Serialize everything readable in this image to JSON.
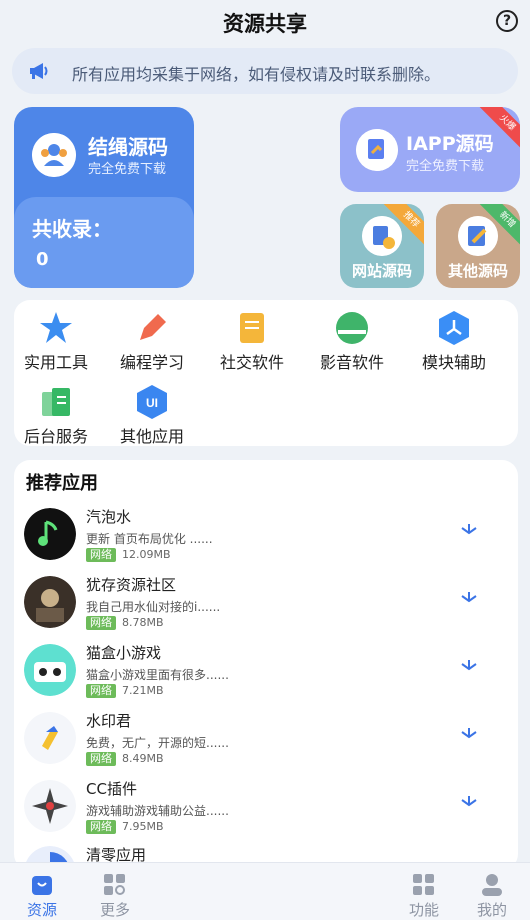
{
  "header": {
    "title": "资源共享",
    "help_icon": "help-icon",
    "help_glyph": "?"
  },
  "notice": {
    "text": "所有应用均采集于网络，如有侵权请及时联系删除。",
    "icon": "megaphone-icon"
  },
  "featured": {
    "main": {
      "name": "结绳源码",
      "subtitle": "完全免费下载",
      "count_label": "共收录：",
      "count": "0"
    },
    "iapp": {
      "name": "IAPP源码",
      "subtitle": "完全免费下载",
      "badge": "火爆"
    },
    "web": {
      "name": "网站源码",
      "badge": "推荐"
    },
    "other": {
      "name": "其他源码",
      "badge": "新增"
    }
  },
  "categories": [
    {
      "label": "实用工具",
      "color": "#3b8df0"
    },
    {
      "label": "编程学习",
      "color": "#f06a4e"
    },
    {
      "label": "社交软件",
      "color": "#f4b63a"
    },
    {
      "label": "影音软件",
      "color": "#3fb46a"
    },
    {
      "label": "模块辅助",
      "color": "#3a8ef6"
    },
    {
      "label": "后台服务",
      "color": "#36b865"
    },
    {
      "label": "其他应用",
      "color": "#3a86f0"
    }
  ],
  "recommend": {
    "title": "推荐应用",
    "apps": [
      {
        "name": "汽泡水",
        "desc": "更新 首页布局优化 ......",
        "tag": "网络",
        "size": "12.09MB"
      },
      {
        "name": "犹存资源社区",
        "desc": "我自己用水仙对接的i......",
        "tag": "网络",
        "size": "8.78MB"
      },
      {
        "name": "猫盒小游戏",
        "desc": "猫盒小游戏里面有很多......",
        "tag": "网络",
        "size": "7.21MB"
      },
      {
        "name": "水印君",
        "desc": "免费，无广，开源的短......",
        "tag": "网络",
        "size": "8.49MB"
      },
      {
        "name": "CC插件",
        "desc": "游戏辅助游戏辅助公益......",
        "tag": "网络",
        "size": "7.95MB"
      },
      {
        "name": "清零应用",
        "desc": "",
        "tag": "",
        "size": ""
      }
    ]
  },
  "nav": [
    {
      "label": "资源",
      "active": true
    },
    {
      "label": "更多",
      "active": false
    },
    {
      "label": "功能",
      "active": false
    },
    {
      "label": "我的",
      "active": false
    }
  ],
  "colors": {
    "accent": "#3b74e6",
    "main_card": "#4e86e8",
    "iapp_card": "#9aa9f6",
    "web_card": "#8cc1c9",
    "other_card": "#c9a78a",
    "tag": "#6dbb5a"
  }
}
